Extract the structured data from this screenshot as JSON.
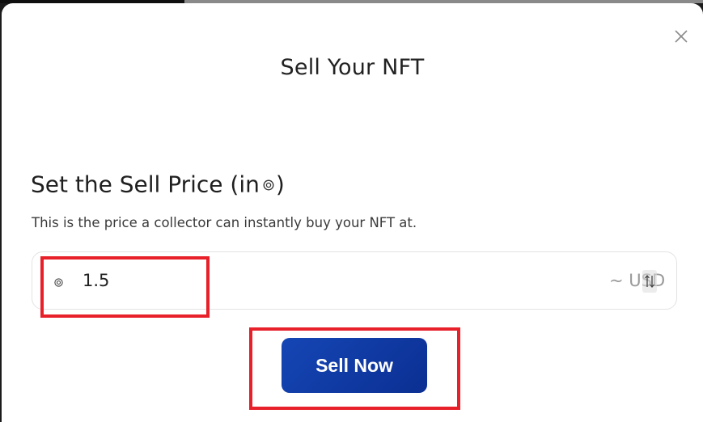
{
  "dialog": {
    "title": "Sell Your NFT",
    "close_icon": "close-icon"
  },
  "price_section": {
    "heading_prefix": "Set the Sell Price (in",
    "heading_suffix": ")",
    "currency_icon": "coin-icon",
    "description": "This is the price a collector can instantly buy your NFT at."
  },
  "price_input": {
    "value": "1.5",
    "usd_label": "~ USD",
    "swap_icon": "swap-vertical-icon"
  },
  "actions": {
    "sell_label": "Sell Now"
  },
  "colors": {
    "accent": "#1546b5",
    "highlight": "#e8202a"
  }
}
